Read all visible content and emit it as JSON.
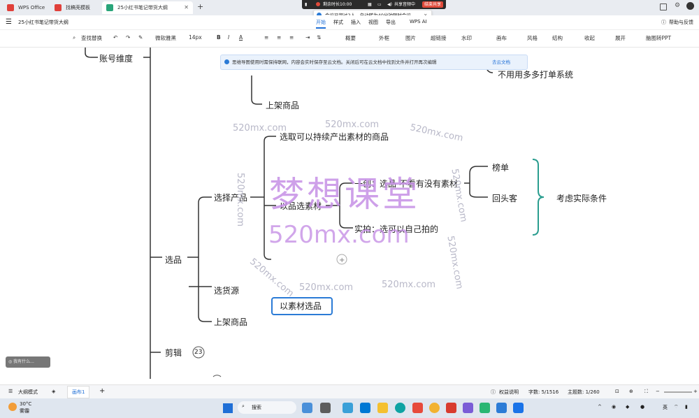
{
  "browser": {
    "tabs": [
      {
        "label": "WPS Office",
        "color": "#e0403a"
      },
      {
        "label": "找稿壳模板",
        "color": "#e0403a"
      },
      {
        "label": "25小红书笔记带货大纲",
        "color": "#2aa57a"
      }
    ],
    "new_tab": "+"
  },
  "meeting": {
    "duration": "剩余时长10:00",
    "sharing": "共享音频中",
    "stop": "结束共享",
    "notice": "会议已超过2人，自动转为40分钟限时会议。"
  },
  "doc": {
    "title": "25小红书笔记带货大纲",
    "menu": [
      "开始",
      "样式",
      "插入",
      "视图",
      "导出",
      "WPS AI"
    ],
    "help": "帮助与反馈"
  },
  "toolbar": {
    "find": "查找替换",
    "font": "微软雅黑",
    "size": "14px",
    "items": [
      "概要",
      "外框",
      "图片",
      "超链接",
      "水印",
      "画布",
      "风格",
      "结构",
      "收起",
      "展开",
      "脑图转PPT"
    ]
  },
  "banner": {
    "text": "思维导图使用时需保持联网，内容会实时保存至云文档。关闭后可在云文档中找到文件并打开再次编辑",
    "link": "去云文档"
  },
  "mindmap": {
    "account": "账号维度",
    "no_multi": "不用用多多打单系统",
    "list_top": "上架商品",
    "pick_lasting": "选取可以持续产出素材的商品",
    "select_product": "选择产品",
    "product_material": "以品选素材",
    "original": "一创：选品 不看有没有素材",
    "shoot": "实拍：选可以自己拍的",
    "rank": "榜单",
    "return": "回头客",
    "consider": "考虑实际条件",
    "material_product": "以素材选品",
    "select": "选品",
    "source": "选货源",
    "list": "上架商品",
    "edit": "剪辑",
    "edit_count": "23",
    "ask": "我有什么..."
  },
  "watermark": {
    "big": "梦想课堂",
    "url": "520mx.com"
  },
  "status": {
    "outline": "大纲模式",
    "canvas": "画布1",
    "rights": "权益说明",
    "chars": "字数: 5/1516",
    "topics": "主题数: 1/260"
  },
  "taskbar": {
    "temp": "30°C",
    "weather": "雾霾",
    "search": "搜索",
    "lang": "英"
  }
}
